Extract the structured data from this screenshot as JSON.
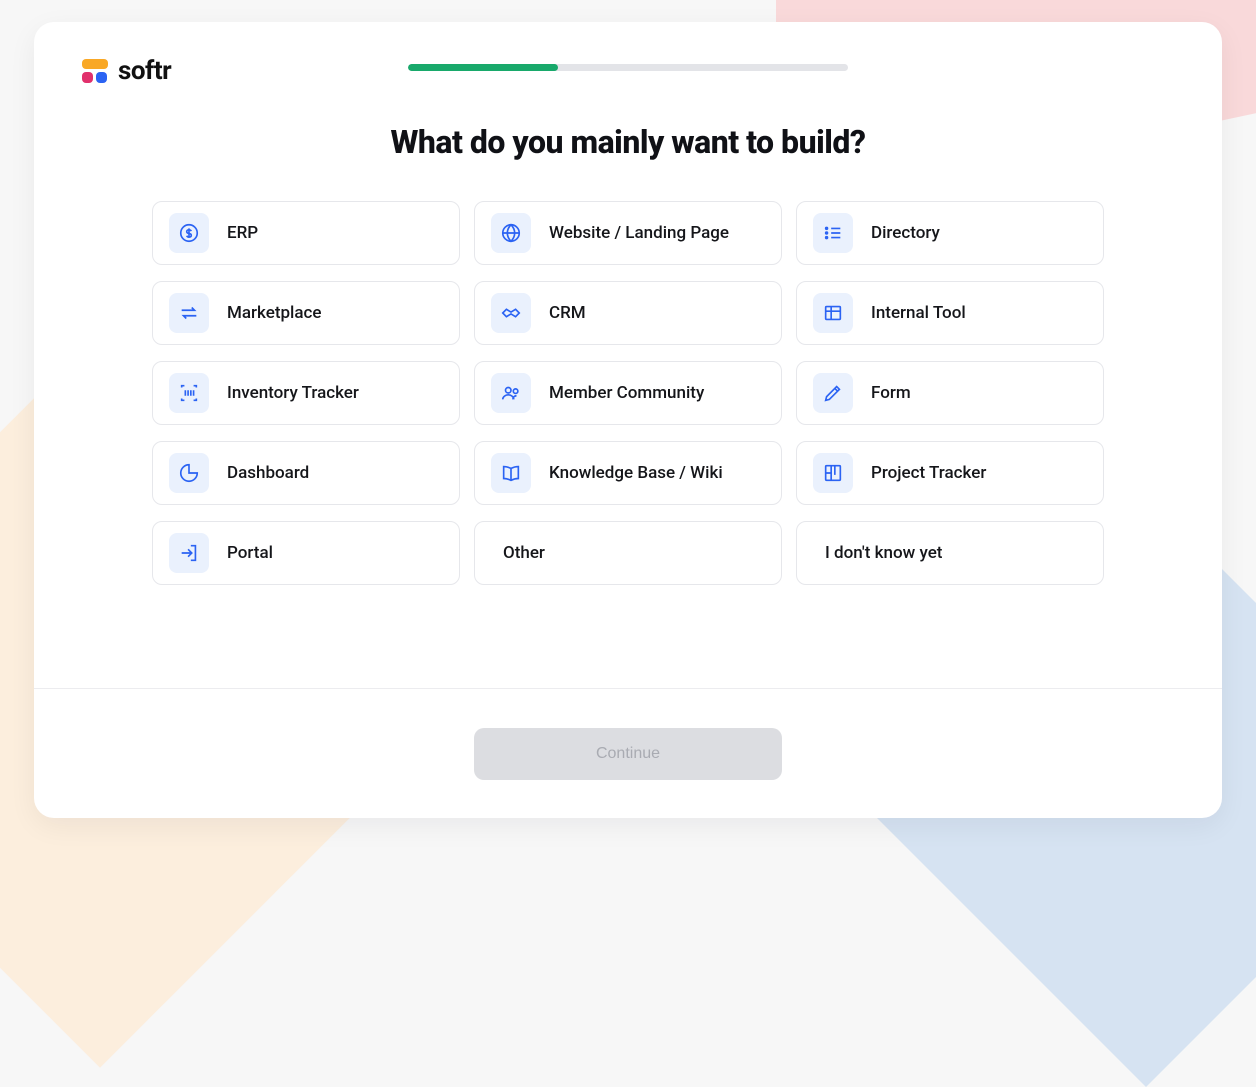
{
  "brand": {
    "name": "softr"
  },
  "progress": {
    "percent": 34
  },
  "headline": "What do you mainly want to build?",
  "options": [
    {
      "key": "erp",
      "label": "ERP",
      "icon": "dollar-circle-icon"
    },
    {
      "key": "website",
      "label": "Website / Landing Page",
      "icon": "globe-icon"
    },
    {
      "key": "directory",
      "label": "Directory",
      "icon": "list-icon"
    },
    {
      "key": "marketplace",
      "label": "Marketplace",
      "icon": "swap-icon"
    },
    {
      "key": "crm",
      "label": "CRM",
      "icon": "handshake-icon"
    },
    {
      "key": "internal",
      "label": "Internal Tool",
      "icon": "table-icon"
    },
    {
      "key": "inventory",
      "label": "Inventory Tracker",
      "icon": "barcode-icon"
    },
    {
      "key": "community",
      "label": "Member Community",
      "icon": "people-icon"
    },
    {
      "key": "form",
      "label": "Form",
      "icon": "pencil-icon"
    },
    {
      "key": "dashboard",
      "label": "Dashboard",
      "icon": "piechart-icon"
    },
    {
      "key": "wiki",
      "label": "Knowledge Base / Wiki",
      "icon": "book-icon"
    },
    {
      "key": "project",
      "label": "Project Tracker",
      "icon": "kanban-icon"
    },
    {
      "key": "portal",
      "label": "Portal",
      "icon": "login-icon"
    },
    {
      "key": "other",
      "label": "Other",
      "icon": null
    },
    {
      "key": "unknown",
      "label": "I don't know yet",
      "icon": null
    }
  ],
  "footer": {
    "continue_label": "Continue",
    "continue_enabled": false
  },
  "colors": {
    "accent_blue": "#2b63f3",
    "progress_green": "#18a96b",
    "icon_bg": "#eaf1fd"
  }
}
